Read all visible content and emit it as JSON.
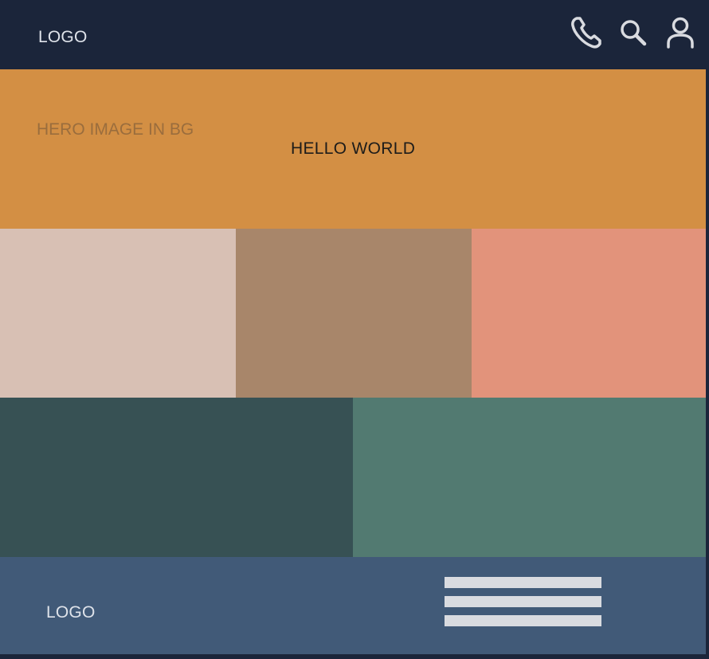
{
  "header": {
    "logo": "LOGO",
    "icons": [
      "phone-icon",
      "search-icon",
      "user-icon"
    ]
  },
  "hero": {
    "caption": "HERO IMAGE IN BG",
    "heading": "HELLO WORLD"
  },
  "tiles": {
    "row1": [
      {
        "color": "#d8c0b4"
      },
      {
        "color": "#a8866a"
      },
      {
        "color": "#e2937b"
      }
    ],
    "row2": [
      {
        "color": "#375154"
      },
      {
        "color": "#527a71"
      }
    ]
  },
  "footer": {
    "logo": "LOGO",
    "menu_icon": "hamburger-menu-icon"
  },
  "colors": {
    "header_bg": "#1b253a",
    "hero_bg": "#d38f44",
    "footer_bg": "#415a78",
    "icon_color": "#d9dbe0"
  }
}
